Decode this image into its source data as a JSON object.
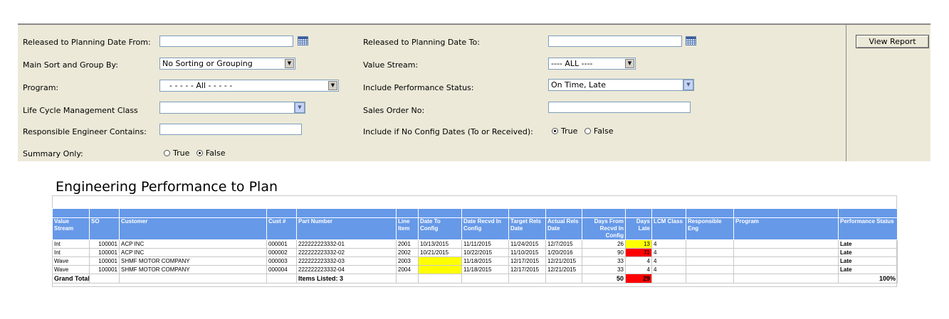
{
  "filters": {
    "released_from_label": "Released to Planning Date From:",
    "released_from_value": "",
    "released_to_label": "Released to Planning Date To:",
    "released_to_value": "",
    "sort_label": "Main Sort and Group By:",
    "sort_value": "No Sorting or Grouping",
    "value_stream_label": "Value Stream:",
    "value_stream_value": "---- ALL ----",
    "program_label": "Program:",
    "program_value": "- - - - - All - - - - -",
    "perf_status_label": "Include Performance Status:",
    "perf_status_value": "On Time, Late",
    "lcm_label": "Life Cycle Management Class",
    "lcm_value": "",
    "sales_order_label": "Sales Order No:",
    "sales_order_value": "",
    "engineer_label": "Responsible Engineer Contains:",
    "engineer_value": "",
    "no_config_label": "Include if No Config Dates (To or Received):",
    "no_config_true": "True",
    "no_config_false": "False",
    "summary_label": "Summary Only:",
    "summary_true": "True",
    "summary_false": "False",
    "view_report": "View Report"
  },
  "report": {
    "title": "Engineering Performance to Plan",
    "columns": [
      "Value Stream",
      "SO",
      "Customer",
      "Cust #",
      "Part Number",
      "Line Item",
      "Date To Config",
      "Date Recvd In Config",
      "Target Rels Date",
      "Actual Rels Date",
      "Days From Recvd In Config",
      "Days Late",
      "LCM Class",
      "Responsible Eng",
      "Program",
      "Performance Status"
    ],
    "rows": [
      [
        "Int",
        "100001",
        "ACP INC",
        "000001",
        "222222223332-01",
        "2001",
        "10/13/2015",
        "11/11/2015",
        "11/24/2015",
        "12/7/2015",
        "26",
        "13",
        "4",
        "",
        "",
        "Late"
      ],
      [
        "Int",
        "100001",
        "ACP INC",
        "000002",
        "222222223332-02",
        "2002",
        "10/21/2015",
        "10/22/2015",
        "11/10/2015",
        "1/20/2016",
        "90",
        "71",
        "4",
        "",
        "",
        "Late"
      ],
      [
        "Wave",
        "100001",
        "SHMF MOTOR  COMPANY",
        "000003",
        "222222223332-03",
        "2003",
        "",
        "11/18/2015",
        "12/17/2015",
        "12/21/2015",
        "33",
        "4",
        "4",
        "",
        "",
        "Late"
      ],
      [
        "Wave",
        "100001",
        "SHMF MOTOR  COMPANY",
        "000004",
        "222222223332-04",
        "2004",
        "",
        "11/18/2015",
        "12/17/2015",
        "12/21/2015",
        "33",
        "4",
        "4",
        "",
        "",
        "Late"
      ]
    ],
    "cell_highlights": [
      {
        "row": 0,
        "col": 11,
        "color": "#ffff00"
      },
      {
        "row": 1,
        "col": 11,
        "color": "#ff0000"
      },
      {
        "row": 2,
        "col": 6,
        "color": "#ffff00"
      },
      {
        "row": 3,
        "col": 6,
        "color": "#ffff00"
      }
    ],
    "total": {
      "label": "Grand Total",
      "items_listed": "Items Listed: 3",
      "days_from_recvd": "50",
      "days_late": "29",
      "performance": "100%"
    }
  }
}
